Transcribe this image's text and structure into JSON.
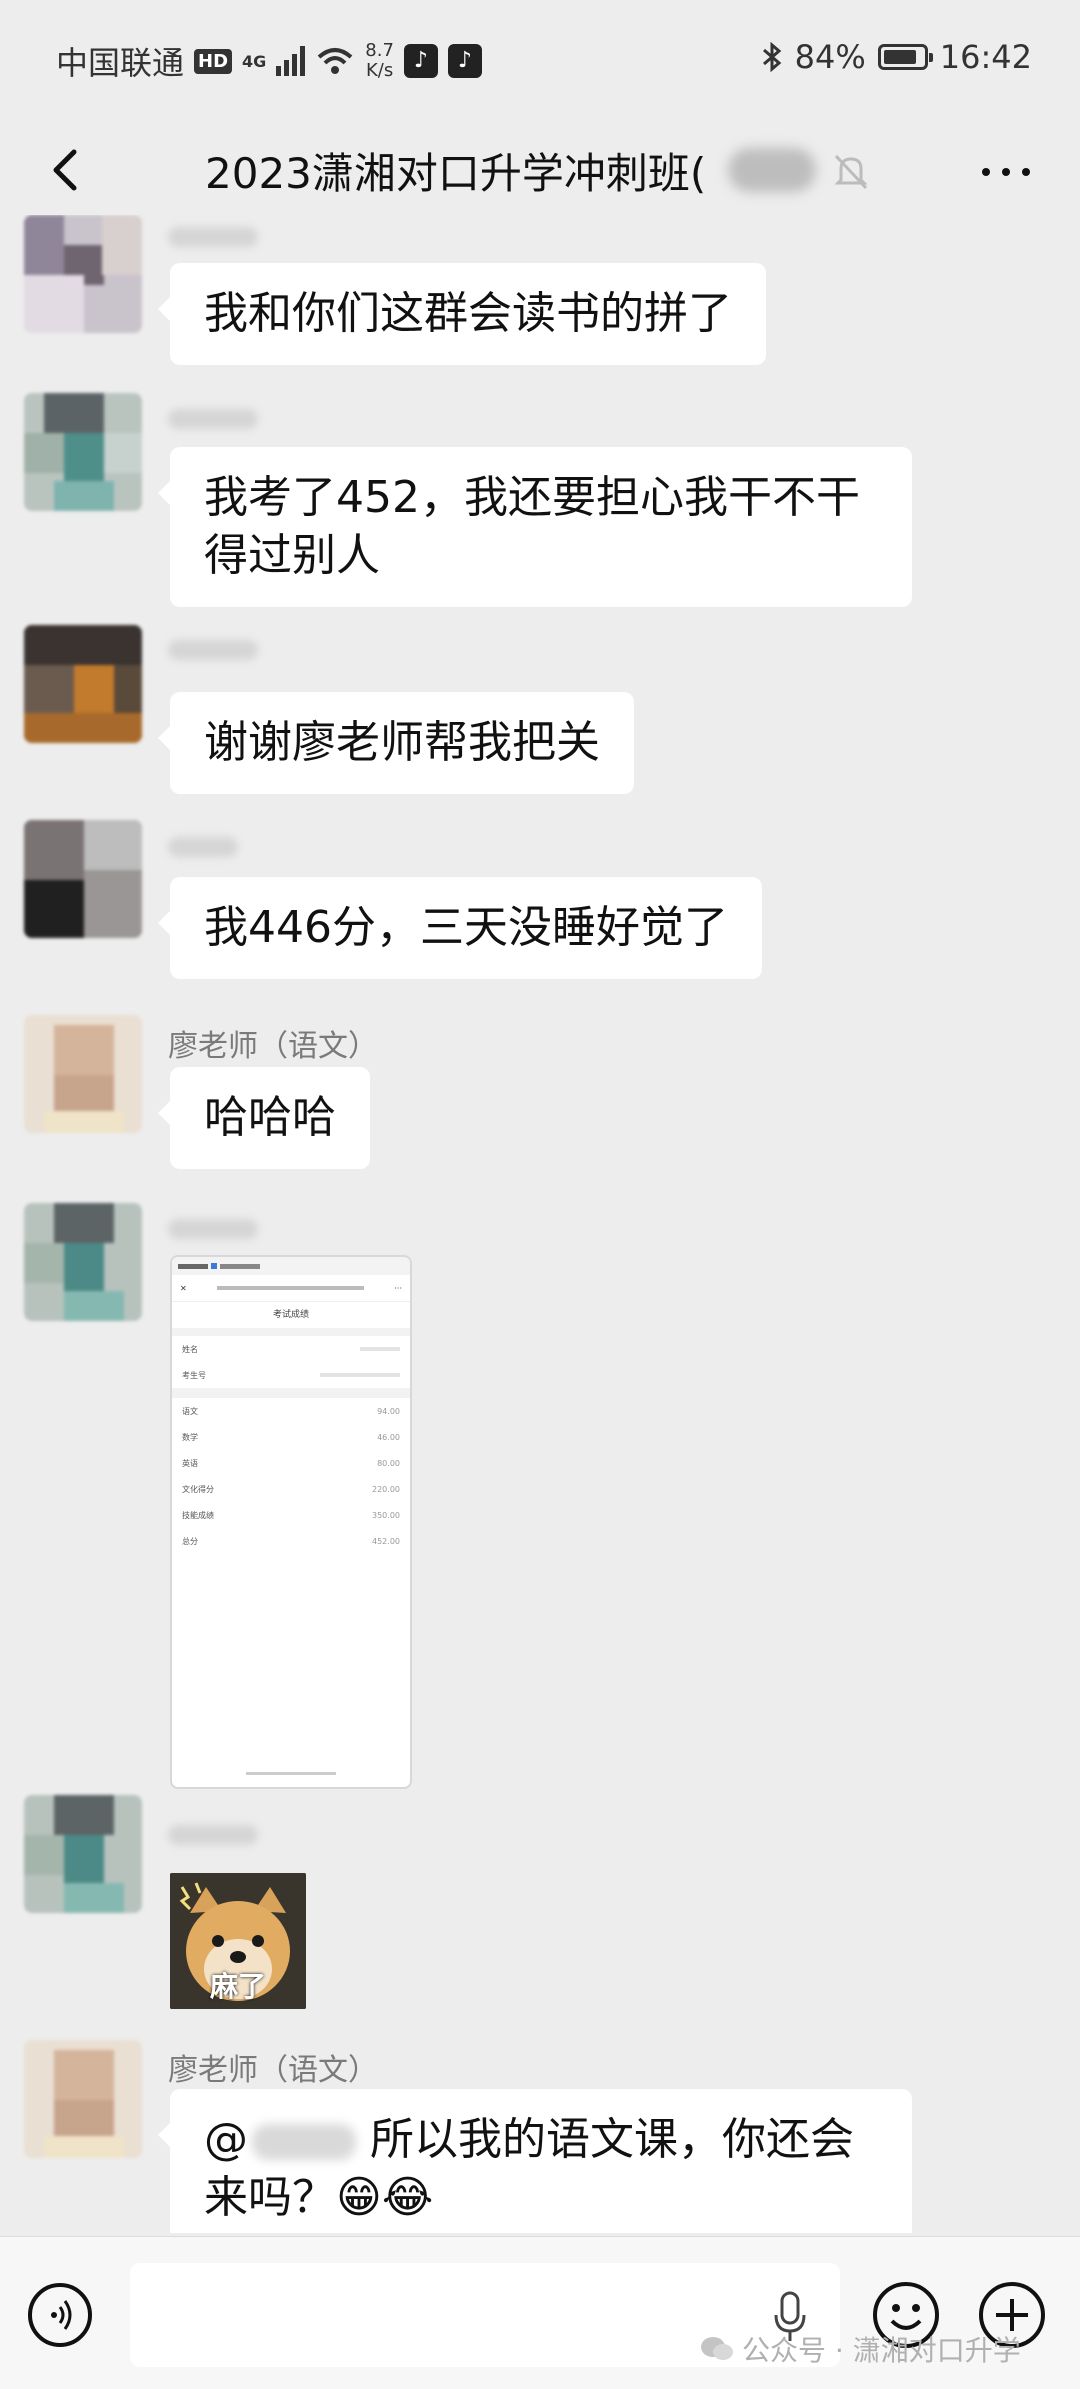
{
  "status_bar": {
    "carrier": "中国联通",
    "hd": "HD",
    "net_type": "4G",
    "speed_value": "8.7",
    "speed_unit": "K/s",
    "battery": "84%",
    "battery_level": 0.84,
    "time": "16:42"
  },
  "nav": {
    "title": "2023潇湘对口升学冲刺班("
  },
  "messages": [
    {
      "sender": "",
      "text": "我和你们这群会读书的拼了"
    },
    {
      "sender": "",
      "text": "我考了452，我还要担心我干不干得过别人"
    },
    {
      "sender": "",
      "text": "谢谢廖老师帮我把关"
    },
    {
      "sender": "",
      "text": "我446分，三天没睡好觉了"
    },
    {
      "sender": "廖老师（语文）",
      "text": "哈哈哈"
    },
    {
      "sender": "",
      "type": "image"
    },
    {
      "sender": "",
      "type": "sticker",
      "caption": "麻了"
    },
    {
      "sender": "廖老师（语文）",
      "text_prefix": "@",
      "text_rest": "所以我的语文课，你还会来吗？",
      "emoji": "😁😂"
    }
  ],
  "score_shot": {
    "title": "考试成绩",
    "rows_top": [
      {
        "label": "姓名",
        "value": ""
      },
      {
        "label": "考生号",
        "value": ""
      }
    ],
    "rows_scores": [
      {
        "label": "语文",
        "value": "94.00"
      },
      {
        "label": "数学",
        "value": "46.00"
      },
      {
        "label": "英语",
        "value": "80.00"
      },
      {
        "label": "文化得分",
        "value": "220.00"
      },
      {
        "label": "技能成绩",
        "value": "350.00"
      },
      {
        "label": "总分",
        "value": "452.00"
      }
    ]
  },
  "input_bar": {
    "watermark": "公众号 · 潇湘对口升学"
  },
  "icons": {
    "back": "chevron-left-icon",
    "mute": "bell-off-icon",
    "more": "more-dots-icon",
    "voice": "voice-icon",
    "mic": "microphone-icon",
    "emoji": "smile-icon",
    "plus": "plus-icon"
  }
}
